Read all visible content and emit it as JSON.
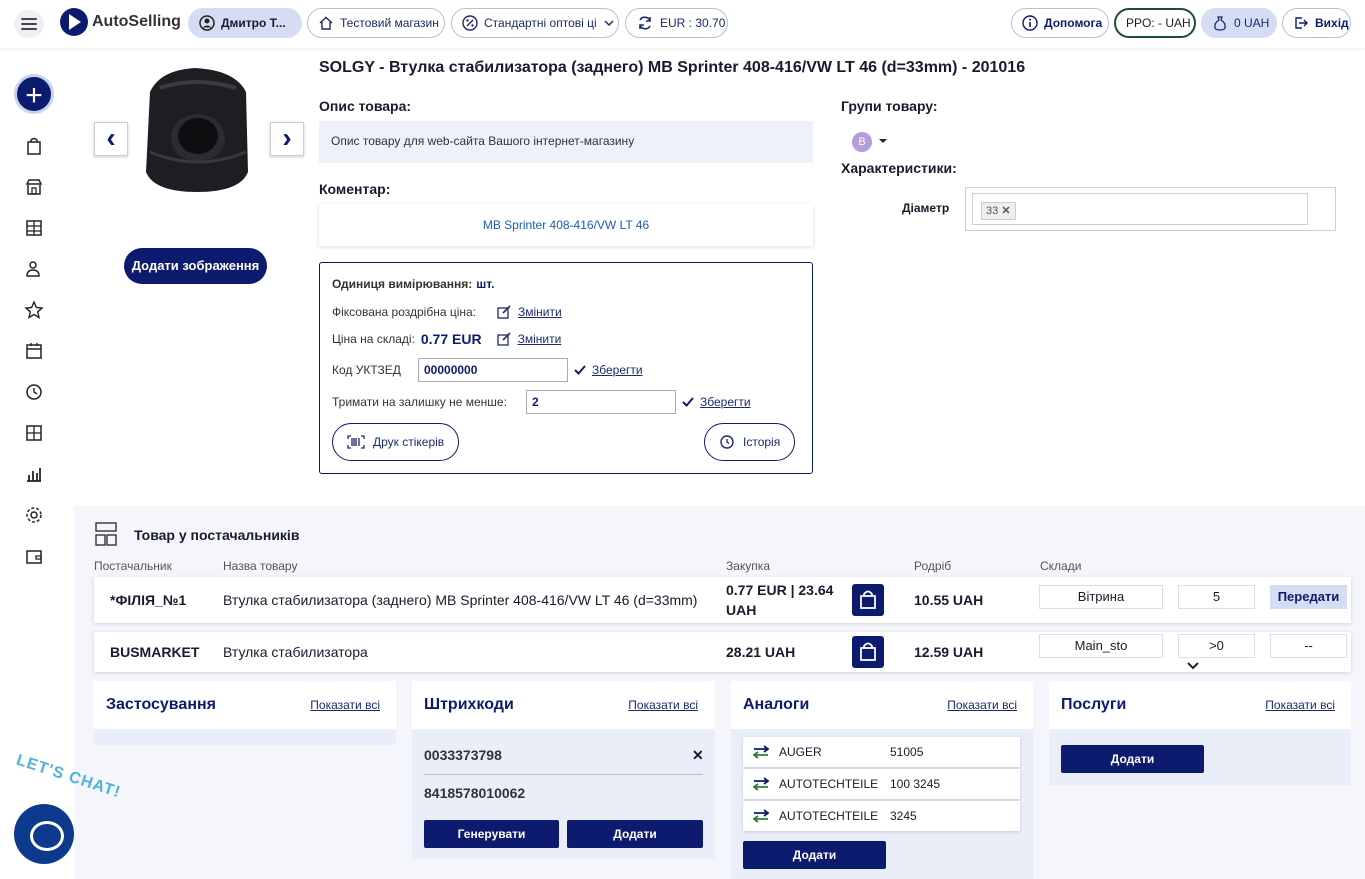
{
  "header": {
    "logo_text": "AutoSelling",
    "user_name": "Дмитро Т...",
    "store": "Тестовий магазин",
    "price_type": "Стандартні оптові ці",
    "currency_rate": "EUR : 30.70",
    "help": "Допомога",
    "prro": "PPO: - UAH",
    "balance": "0 UAH",
    "exit": "Вихід"
  },
  "sidebar": {
    "icons": [
      "bag-icon",
      "store-icon",
      "warehouse-icon",
      "users-icon",
      "star-icon",
      "calendar-icon",
      "history-icon",
      "catalog-icon",
      "stats-icon",
      "settings-icon",
      "wallet-icon"
    ],
    "chat_label": "LET'S CHAT!"
  },
  "product": {
    "title": "SOLGY - Втулка стабилизатора (заднего) MB Sprinter 408-416/VW LT 46 (d=33mm) - 201016",
    "add_image": "Додати зображення",
    "description_label": "Опис товара:",
    "description_placeholder": "Опис товару для web-сайта Вашого інтернет-магазину",
    "comment_label": "Коментар:",
    "comment": "MB Sprinter 408-416/VW LT 46",
    "unit_label": "Одиниця вимірювання:",
    "unit": "шт.",
    "fixed_price_label": "Фіксована роздрібна ціна:",
    "change": "Змінити",
    "stock_price_label": "Ціна на складі:",
    "stock_price": "0.77 EUR",
    "uktzed_label": "Код УКТЗЕД",
    "uktzed_value": "00000000",
    "save": "Зберегти",
    "min_stock_label": "Тримати на залишку не менше:",
    "min_stock_value": "2",
    "print_stickers": "Друк стікерів",
    "history": "Історія",
    "groups_label": "Групи товару:",
    "group_badge": "B",
    "characteristics_label": "Характеристики:",
    "diameter_label": "Діаметр",
    "diameter_value": "33"
  },
  "suppliers": {
    "title": "Товар у постачальників",
    "columns": [
      "Постачальник",
      "Назва товару",
      "Закупка",
      "Родріб",
      "Склади"
    ],
    "rows": [
      {
        "supplier": "*ФІЛІЯ_№1",
        "name": "Втулка стабилизатора (заднего) MB Sprinter 408-416/VW LT 46 (d=33mm)",
        "purchase": "0.77 EUR | 23.64 UAH",
        "retail": "10.55 UAH",
        "warehouse": "Вітрина",
        "qty": "5",
        "action": "Передати"
      },
      {
        "supplier": "BUSMARKET",
        "name": "Втулка стабилизатора",
        "purchase": "28.21 UAH",
        "retail": "12.59 UAH",
        "warehouse": "Main_sto",
        "qty": ">0",
        "action": "--"
      }
    ]
  },
  "panels": {
    "show_all": "Показати всі",
    "usage": {
      "title": "Застосування"
    },
    "barcodes": {
      "title": "Штрихкоди",
      "items": [
        "0033373798",
        "8418578010062"
      ],
      "generate": "Генерувати",
      "add": "Додати"
    },
    "analogs": {
      "title": "Аналоги",
      "items": [
        {
          "brand": "AUGER",
          "code": "51005"
        },
        {
          "brand": "AUTOTECHTEILE",
          "code": "100 3245"
        },
        {
          "brand": "AUTOTECHTEILE",
          "code": "3245"
        }
      ],
      "add": "Додати"
    },
    "services": {
      "title": "Послуги",
      "add": "Додати"
    }
  },
  "colors": {
    "accent": "#0d1b6e",
    "link": "#1a5dba",
    "panel_bg": "#e9eef9"
  }
}
